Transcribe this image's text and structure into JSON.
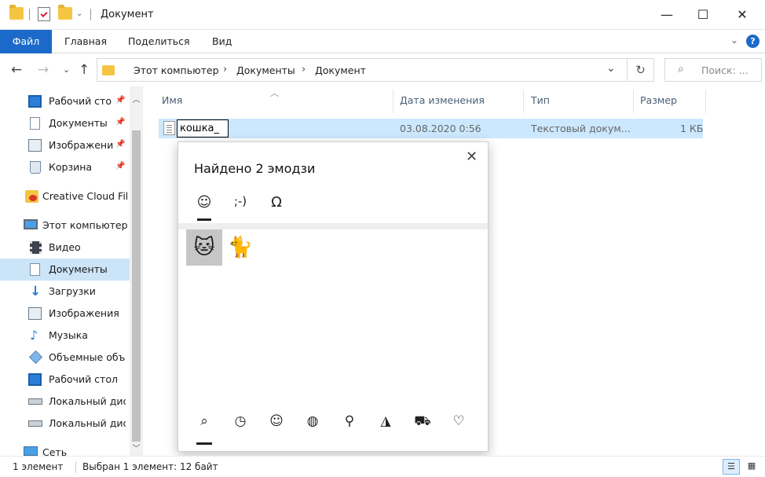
{
  "window": {
    "title": "Документ",
    "minimize": "—",
    "maximize": "☐",
    "close": "✕"
  },
  "ribbon": {
    "tabs": [
      "Файл",
      "Главная",
      "Поделиться",
      "Вид"
    ],
    "collapse": "⌄",
    "help": "?"
  },
  "address": {
    "back": "←",
    "forward": "→",
    "recent": "⌄",
    "up": "↑",
    "crumbs": [
      "Этот компьютер",
      "Документы",
      "Документ"
    ],
    "separator": "›",
    "dropdown": "⌄",
    "refresh": "↻",
    "search_placeholder": "Поиск: ..."
  },
  "nav": {
    "items": [
      {
        "label": "Рабочий сто",
        "icon": "desktop-icon",
        "pinned": true
      },
      {
        "label": "Документы",
        "icon": "documents-icon",
        "pinned": true
      },
      {
        "label": "Изображени",
        "icon": "pictures-icon",
        "pinned": true
      },
      {
        "label": "Корзина",
        "icon": "recycle-bin-icon",
        "pinned": true
      },
      {
        "label": "Creative Cloud Fil",
        "icon": "creative-cloud-icon",
        "pinned": false
      },
      {
        "label": "Этот компьютер",
        "icon": "computer-icon",
        "pinned": false
      },
      {
        "label": "Видео",
        "icon": "video-icon",
        "pinned": false
      },
      {
        "label": "Документы",
        "icon": "documents-icon",
        "pinned": false,
        "selected": true
      },
      {
        "label": "Загрузки",
        "icon": "downloads-icon",
        "pinned": false
      },
      {
        "label": "Изображения",
        "icon": "pictures-icon",
        "pinned": false
      },
      {
        "label": "Музыка",
        "icon": "music-icon",
        "pinned": false
      },
      {
        "label": "Объемные объ",
        "icon": "3d-objects-icon",
        "pinned": false
      },
      {
        "label": "Рабочий стол",
        "icon": "desktop-icon",
        "pinned": false
      },
      {
        "label": "Локальный дис",
        "icon": "drive-icon",
        "pinned": false
      },
      {
        "label": "Локальный дис",
        "icon": "drive-icon",
        "pinned": false
      },
      {
        "label": "Сеть",
        "icon": "network-icon",
        "pinned": false
      }
    ]
  },
  "columns": [
    "Имя",
    "Дата изменения",
    "Тип",
    "Размер"
  ],
  "file": {
    "name": "кошка_",
    "date": "03.08.2020 0:56",
    "type": "Текстовый докум...",
    "size": "1 КБ"
  },
  "emoji_panel": {
    "title": "Найдено 2 эмодзи",
    "close": "✕",
    "tabs": [
      "☺",
      ";-)",
      "Ω"
    ],
    "results": [
      "🐱",
      "🐈"
    ],
    "categories": [
      "search-icon",
      "recent-icon",
      "smiley-icon",
      "people-icon",
      "places-icon",
      "food-icon",
      "travel-icon",
      "heart-icon"
    ],
    "category_glyphs": [
      "⌕",
      "◷",
      "☺",
      "◍",
      "⚲",
      "◮",
      "⛟",
      "♡"
    ]
  },
  "status": {
    "count": "1 элемент",
    "selection": "Выбран 1 элемент: 12 байт"
  },
  "colors": {
    "accent": "#1b6ac9",
    "selection": "#cce8ff",
    "nav_selected": "#cce4f7"
  }
}
